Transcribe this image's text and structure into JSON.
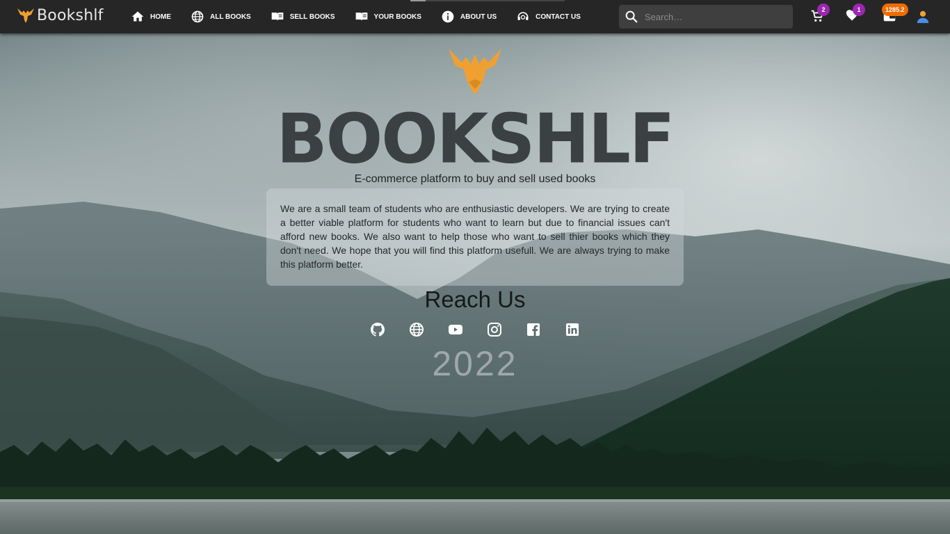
{
  "brand": {
    "name": "Bookshlf"
  },
  "nav": {
    "home": "HOME",
    "all_books": "ALL BOOKS",
    "sell_books": "SELL BOOKS",
    "your_books": "YOUR BOOKS",
    "about_us": "ABOUT US",
    "contact_us": "CONTACT US"
  },
  "search": {
    "placeholder": "Search…",
    "value": ""
  },
  "badges": {
    "cart": "2",
    "wishlist": "1",
    "wallet": "1285.2"
  },
  "hero": {
    "title": "BOOKSHLF",
    "subtitle": "E-commerce platform to buy and sell used books",
    "about": "We are a small team of students who are enthusiastic developers. We are trying to create a better viable platform for students who want to learn but due to financial issues can't afford new books. We also want to help those who want to sell thier books which they don't need. We hope that you will find this platform usefull. We are always trying to make this platform better.",
    "reach_title": "Reach Us",
    "year": "2022"
  },
  "socials": [
    "github-icon",
    "globe-icon",
    "youtube-icon",
    "instagram-icon",
    "facebook-icon",
    "linkedin-icon"
  ],
  "colors": {
    "navbar": "#262626",
    "accent_orange": "#f0a030",
    "badge_purple": "#9c27b0",
    "badge_orange": "#ef6c00",
    "title_dark": "#3b4142"
  }
}
